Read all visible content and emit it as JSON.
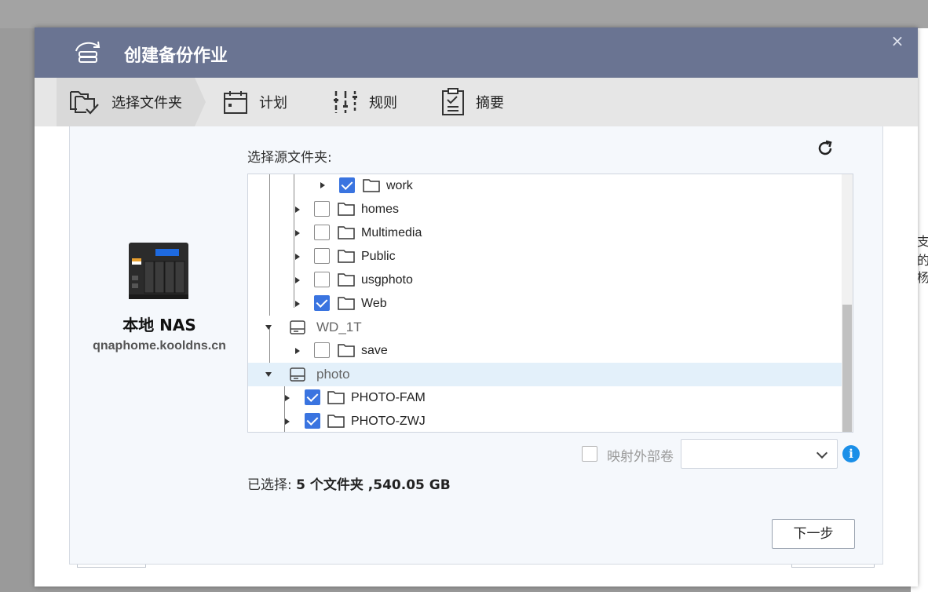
{
  "dialog": {
    "title": "创建备份作业",
    "close_label": "×",
    "icon": "backup-disk-icon"
  },
  "steps": [
    {
      "label": "选择文件夹",
      "icon": "folder-check-icon",
      "active": true
    },
    {
      "label": "计划",
      "icon": "calendar-icon",
      "active": false
    },
    {
      "label": "规则",
      "icon": "sliders-icon",
      "active": false
    },
    {
      "label": "摘要",
      "icon": "clipboard-icon",
      "active": false
    }
  ],
  "source": {
    "device_name": "本地 NAS",
    "host": "qnaphome.kooldns.cn",
    "device_icon": "nas-icon"
  },
  "folder_picker": {
    "label": "选择源文件夹:",
    "refresh_icon": "refresh-icon",
    "rows": [
      {
        "name": "work",
        "type": "folder",
        "checked": true
      },
      {
        "name": "homes",
        "type": "folder",
        "checked": false
      },
      {
        "name": "Multimedia",
        "type": "folder",
        "checked": false
      },
      {
        "name": "Public",
        "type": "folder",
        "checked": false
      },
      {
        "name": "usgphoto",
        "type": "folder",
        "checked": false
      },
      {
        "name": "Web",
        "type": "folder",
        "checked": true
      },
      {
        "name": "WD_1T",
        "type": "volume",
        "expanded": true
      },
      {
        "name": "save",
        "type": "folder",
        "checked": false
      },
      {
        "name": "photo",
        "type": "volume",
        "expanded": true,
        "selected": true
      },
      {
        "name": "PHOTO-FAM",
        "type": "folder",
        "checked": true
      },
      {
        "name": "PHOTO-ZWJ",
        "type": "folder",
        "checked": true
      }
    ]
  },
  "mapping": {
    "label": "映射外部卷",
    "checked": false,
    "selected_value": "",
    "info_icon": "info-icon"
  },
  "summary": {
    "prefix": "已选择: ",
    "value": "5 个文件夹 ,540.05 GB"
  },
  "footer": {
    "next_label": "下一步"
  },
  "background": {
    "partial_text": [
      "支",
      "的",
      "杨"
    ]
  },
  "colors": {
    "titlebar": "#6a7492",
    "accent": "#3a74e0",
    "info": "#1a8fe8",
    "selected_row": "#e3f0fa"
  }
}
